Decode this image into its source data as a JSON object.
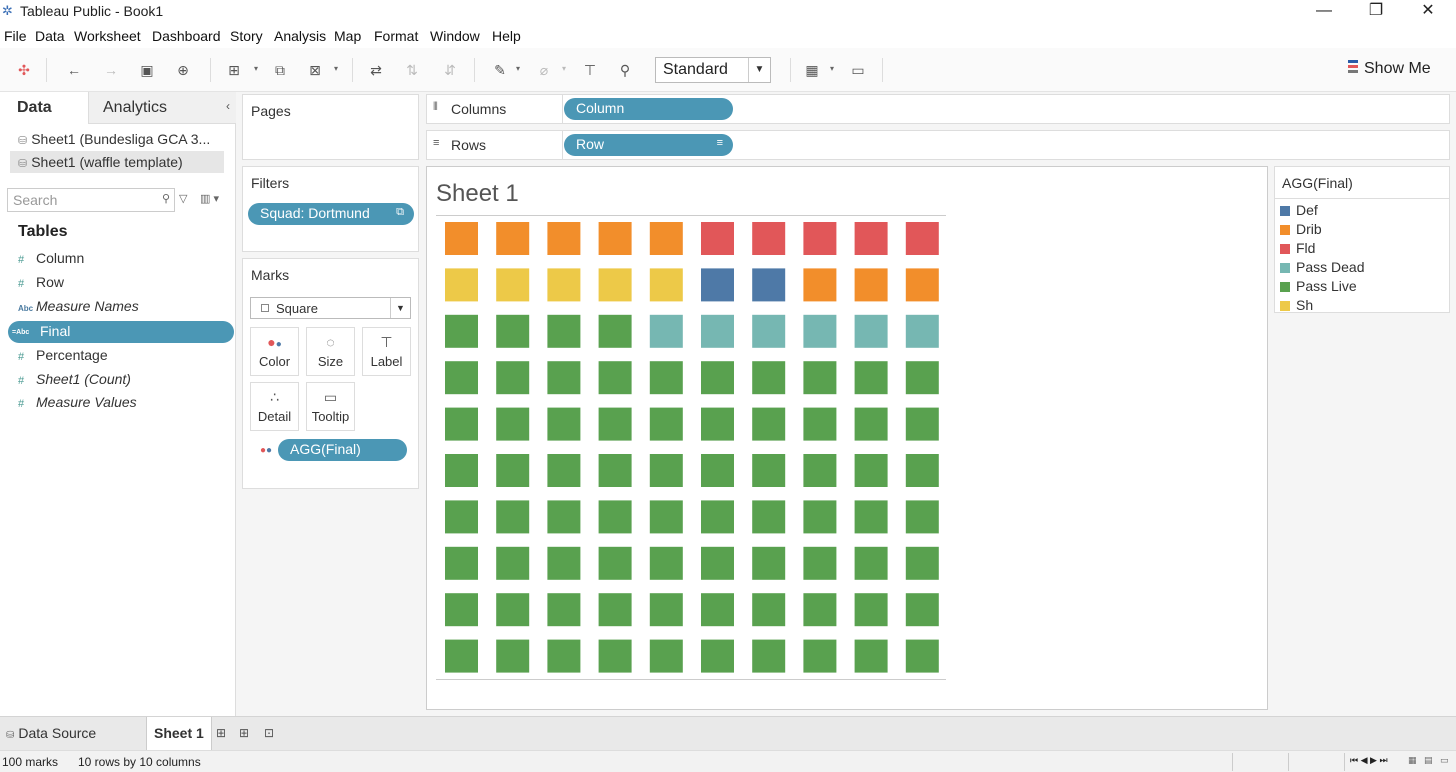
{
  "window": {
    "title": "Tableau Public - Book1"
  },
  "menu": [
    "File",
    "Data",
    "Worksheet",
    "Dashboard",
    "Story",
    "Analysis",
    "Map",
    "Format",
    "Window",
    "Help"
  ],
  "toolbar": {
    "fit_value": "Standard",
    "show_me_label": "Show Me"
  },
  "data_pane": {
    "tab_data": "Data",
    "tab_analytics": "Analytics",
    "datasources": [
      "Sheet1 (Bundesliga GCA 3...",
      "Sheet1 (waffle template)"
    ],
    "search_placeholder": "Search",
    "tables_heading": "Tables",
    "fields": [
      {
        "name": "Column",
        "type": "#"
      },
      {
        "name": "Row",
        "type": "#"
      },
      {
        "name": "Measure Names",
        "type": "Abc"
      },
      {
        "name": "Final",
        "type": "=Abc"
      },
      {
        "name": "Percentage",
        "type": "#"
      },
      {
        "name": "Sheet1 (Count)",
        "type": "#"
      },
      {
        "name": "Measure Values",
        "type": "#"
      }
    ]
  },
  "cards": {
    "pages_title": "Pages",
    "filters_title": "Filters",
    "filter_pill": "Squad: Dortmund",
    "marks_title": "Marks",
    "mark_type": "Square",
    "mark_buttons": [
      "Color",
      "Size",
      "Label",
      "Detail",
      "Tooltip"
    ],
    "color_pill": "AGG(Final)"
  },
  "shelves": {
    "columns_label": "Columns",
    "columns_pill": "Column",
    "rows_label": "Rows",
    "rows_pill": "Row"
  },
  "view": {
    "sheet_title": "Sheet 1"
  },
  "colors": {
    "Def": "#4e79a7",
    "Drib": "#f28e2b",
    "Fld": "#e15759",
    "Pass Dead": "#76b7b2",
    "Pass Live": "#59a14f",
    "Sh": "#edc948"
  },
  "legend": {
    "title": "AGG(Final)",
    "items": [
      "Def",
      "Drib",
      "Fld",
      "Pass Dead",
      "Pass Live",
      "Sh"
    ]
  },
  "waffle": {
    "rows": [
      [
        "Drib",
        "Drib",
        "Drib",
        "Drib",
        "Drib",
        "Fld",
        "Fld",
        "Fld",
        "Fld",
        "Fld"
      ],
      [
        "Sh",
        "Sh",
        "Sh",
        "Sh",
        "Sh",
        "Def",
        "Def",
        "Drib",
        "Drib",
        "Drib"
      ],
      [
        "Pass Live",
        "Pass Live",
        "Pass Live",
        "Pass Live",
        "Pass Dead",
        "Pass Dead",
        "Pass Dead",
        "Pass Dead",
        "Pass Dead",
        "Pass Dead"
      ],
      [
        "Pass Live",
        "Pass Live",
        "Pass Live",
        "Pass Live",
        "Pass Live",
        "Pass Live",
        "Pass Live",
        "Pass Live",
        "Pass Live",
        "Pass Live"
      ],
      [
        "Pass Live",
        "Pass Live",
        "Pass Live",
        "Pass Live",
        "Pass Live",
        "Pass Live",
        "Pass Live",
        "Pass Live",
        "Pass Live",
        "Pass Live"
      ],
      [
        "Pass Live",
        "Pass Live",
        "Pass Live",
        "Pass Live",
        "Pass Live",
        "Pass Live",
        "Pass Live",
        "Pass Live",
        "Pass Live",
        "Pass Live"
      ],
      [
        "Pass Live",
        "Pass Live",
        "Pass Live",
        "Pass Live",
        "Pass Live",
        "Pass Live",
        "Pass Live",
        "Pass Live",
        "Pass Live",
        "Pass Live"
      ],
      [
        "Pass Live",
        "Pass Live",
        "Pass Live",
        "Pass Live",
        "Pass Live",
        "Pass Live",
        "Pass Live",
        "Pass Live",
        "Pass Live",
        "Pass Live"
      ],
      [
        "Pass Live",
        "Pass Live",
        "Pass Live",
        "Pass Live",
        "Pass Live",
        "Pass Live",
        "Pass Live",
        "Pass Live",
        "Pass Live",
        "Pass Live"
      ],
      [
        "Pass Live",
        "Pass Live",
        "Pass Live",
        "Pass Live",
        "Pass Live",
        "Pass Live",
        "Pass Live",
        "Pass Live",
        "Pass Live",
        "Pass Live"
      ]
    ]
  },
  "tabs": {
    "data_source": "Data Source",
    "sheet1": "Sheet 1"
  },
  "status": {
    "marks": "100 marks",
    "dims": "10 rows by 10 columns"
  }
}
